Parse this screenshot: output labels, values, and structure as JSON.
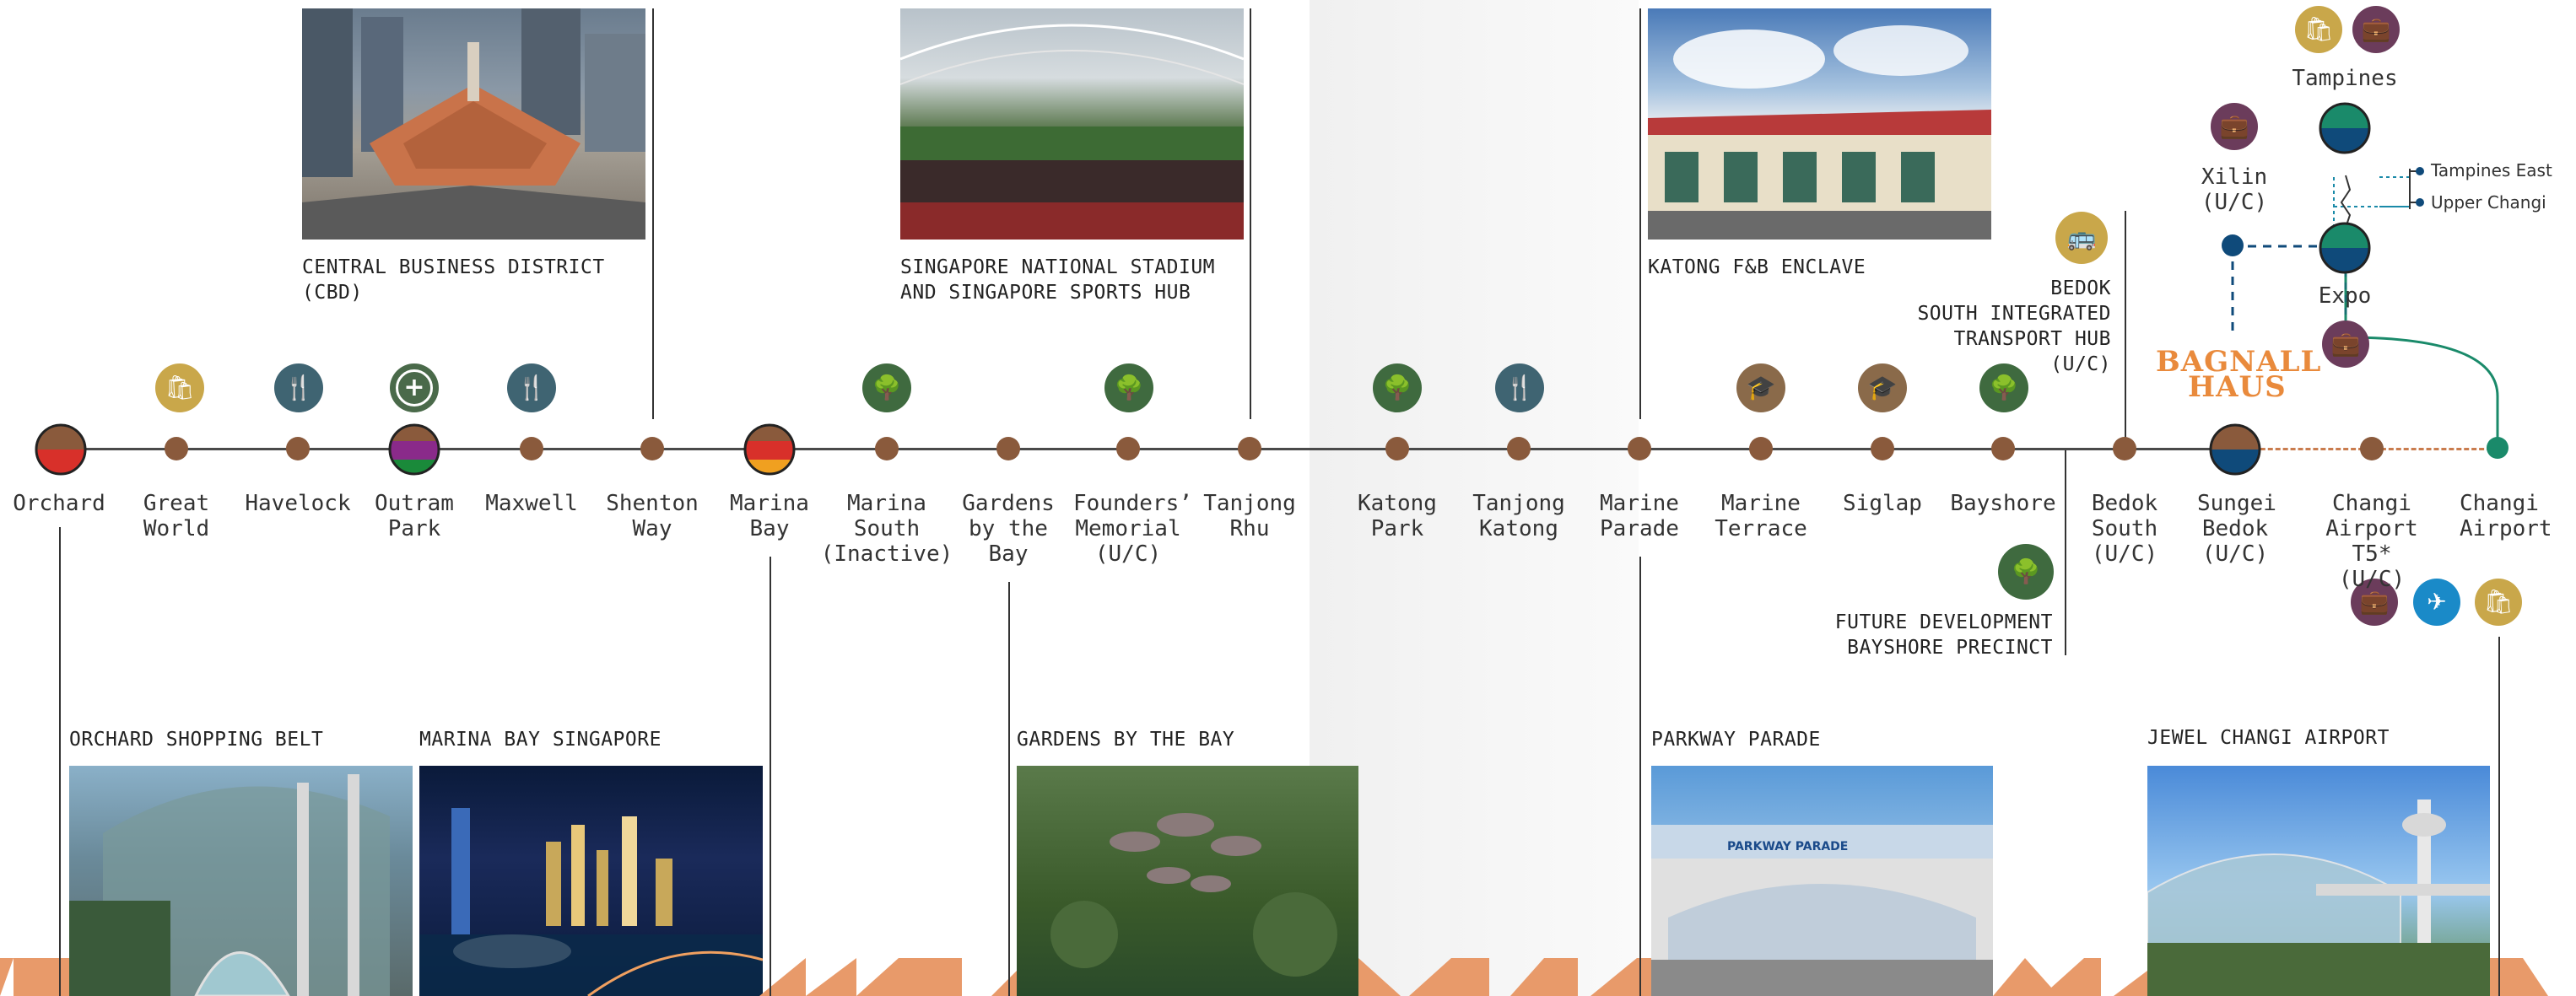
{
  "stations": [
    {
      "name": "Orchard",
      "status": ""
    },
    {
      "name": "Great World",
      "status": ""
    },
    {
      "name": "Havelock",
      "status": ""
    },
    {
      "name": "Outram Park",
      "status": ""
    },
    {
      "name": "Maxwell",
      "status": ""
    },
    {
      "name": "Shenton Way",
      "status": ""
    },
    {
      "name": "Marina Bay",
      "status": ""
    },
    {
      "name": "Marina South",
      "status": "(Inactive)"
    },
    {
      "name": "Gardens by the Bay",
      "status": ""
    },
    {
      "name": "Founders’ Memorial",
      "status": "(U/C)"
    },
    {
      "name": "Tanjong Rhu",
      "status": ""
    },
    {
      "name": "Katong Park",
      "status": ""
    },
    {
      "name": "Tanjong Katong",
      "status": ""
    },
    {
      "name": "Marine Parade",
      "status": ""
    },
    {
      "name": "Marine Terrace",
      "status": ""
    },
    {
      "name": "Siglap",
      "status": ""
    },
    {
      "name": "Bayshore",
      "status": ""
    },
    {
      "name": "Bedok South",
      "status": "(U/C)"
    },
    {
      "name": "Sungei Bedok",
      "status": "(U/C)"
    },
    {
      "name": "Changi Airport T5*",
      "status": "(U/C)"
    },
    {
      "name": "Changi Airport",
      "status": ""
    }
  ],
  "branch": {
    "tampines": "Tampines",
    "expo": "Expo",
    "xilin": "Xilin",
    "xilin_status": "(U/C)",
    "tampines_east": "Tampines East",
    "upper_changi": "Upper Changi"
  },
  "captions": {
    "cbd": "CENTRAL BUSINESS DISTRICT\n(CBD)",
    "stadium": "SINGAPORE NATIONAL STADIUM\nAND SINGAPORE SPORTS HUB",
    "katong": "KATONG F&B ENCLAVE",
    "bedok_hub": "BEDOK\nSOUTH INTEGRATED\nTRANSPORT HUB\n(U/C)",
    "bayshore": "FUTURE DEVELOPMENT\nBAYSHORE PRECINCT",
    "orchard": "ORCHARD SHOPPING BELT",
    "marina": "MARINA BAY SINGAPORE",
    "gardens": "GARDENS BY THE BAY",
    "parkway": "PARKWAY PARADE",
    "jewel": "JEWEL CHANGI AIRPORT"
  },
  "brand": {
    "line1": "BAGNALL",
    "line2": "HAUS"
  },
  "photo_signs": {
    "parkway": "PARKWAY PARADE"
  },
  "colors": {
    "station_dot": "#8a5a3c",
    "shopping": "#c9a74a",
    "dining": "#3f6472",
    "nature": "#3f6a3f",
    "work": "#6b3c5b",
    "education": "#8a6a4a",
    "airport": "#1a8ac8",
    "line": "#4a4a4a",
    "accent": "#e98a3c",
    "teal": "#1a8a6a",
    "navy": "#0f4a7a"
  }
}
